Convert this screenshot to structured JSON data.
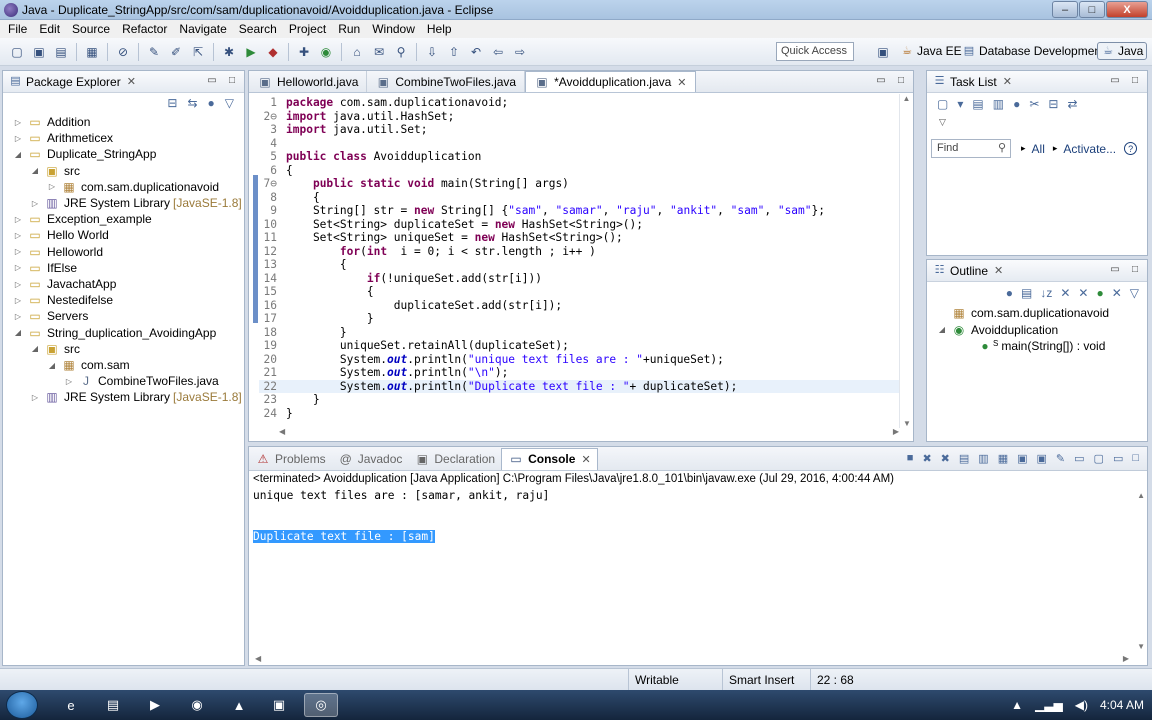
{
  "window": {
    "title": "Java - Duplicate_StringApp/src/com/sam/duplicationavoid/Avoidduplication.java - Eclipse",
    "min": "–",
    "max": "□",
    "close": "X"
  },
  "menu": [
    "File",
    "Edit",
    "Source",
    "Refactor",
    "Navigate",
    "Search",
    "Project",
    "Run",
    "Window",
    "Help"
  ],
  "toolbar": {
    "quick_access_placeholder": "Quick Access",
    "perspectives": [
      {
        "label": "Java EE",
        "icon": "java-ee-icon"
      },
      {
        "label": "Database Development",
        "icon": "database-icon"
      },
      {
        "label": "Java",
        "icon": "java-perspective-icon",
        "active": true
      }
    ]
  },
  "package_explorer": {
    "title": "Package Explorer",
    "close": "✕",
    "items": [
      {
        "label": "Addition",
        "indent": 0,
        "twisty": "▷",
        "icon": "project-icon"
      },
      {
        "label": "Arithmeticex",
        "indent": 0,
        "twisty": "▷",
        "icon": "project-icon"
      },
      {
        "label": "Duplicate_StringApp",
        "indent": 0,
        "twisty": "◢",
        "icon": "project-icon"
      },
      {
        "label": "src",
        "indent": 1,
        "twisty": "◢",
        "icon": "source-folder-icon"
      },
      {
        "label": "com.sam.duplicationavoid",
        "indent": 2,
        "twisty": "▷",
        "icon": "package-icon"
      },
      {
        "label": "JRE System Library",
        "suffix": "[JavaSE-1.8]",
        "indent": 1,
        "twisty": "▷",
        "icon": "library-icon"
      },
      {
        "label": "Exception_example",
        "indent": 0,
        "twisty": "▷",
        "icon": "project-icon"
      },
      {
        "label": "Hello World",
        "indent": 0,
        "twisty": "▷",
        "icon": "project-icon"
      },
      {
        "label": "Helloworld",
        "indent": 0,
        "twisty": "▷",
        "icon": "project-icon"
      },
      {
        "label": "IfElse",
        "indent": 0,
        "twisty": "▷",
        "icon": "project-icon"
      },
      {
        "label": "JavachatApp",
        "indent": 0,
        "twisty": "▷",
        "icon": "project-icon"
      },
      {
        "label": "Nestedifelse",
        "indent": 0,
        "twisty": "▷",
        "icon": "project-icon"
      },
      {
        "label": "Servers",
        "indent": 0,
        "twisty": "▷",
        "icon": "project-icon"
      },
      {
        "label": "String_duplication_AvoidingApp",
        "indent": 0,
        "twisty": "◢",
        "icon": "project-icon"
      },
      {
        "label": "src",
        "indent": 1,
        "twisty": "◢",
        "icon": "source-folder-icon"
      },
      {
        "label": "com.sam",
        "indent": 2,
        "twisty": "◢",
        "icon": "package-icon"
      },
      {
        "label": "CombineTwoFiles.java",
        "indent": 3,
        "twisty": "▷",
        "icon": "java-file-icon"
      },
      {
        "label": "JRE System Library",
        "suffix": "[JavaSE-1.8]",
        "indent": 1,
        "twisty": "▷",
        "icon": "library-icon"
      }
    ]
  },
  "editor": {
    "tabs": [
      {
        "label": "Helloworld.java",
        "active": false
      },
      {
        "label": "CombineTwoFiles.java",
        "active": false
      },
      {
        "label": "*Avoidduplication.java",
        "active": true,
        "close": "✕"
      }
    ],
    "lines": [
      {
        "n": "1",
        "html": "<span class=\"kw\">package</span> com.sam.duplicationavoid;"
      },
      {
        "n": "2⊖",
        "html": "<span class=\"kw\">import</span> java.util.HashSet;"
      },
      {
        "n": "3",
        "html": "<span class=\"kw\">import</span> java.util.Set;"
      },
      {
        "n": "4",
        "html": ""
      },
      {
        "n": "5",
        "html": "<span class=\"kw\">public class</span> Avoidduplication"
      },
      {
        "n": "6",
        "html": "{"
      },
      {
        "n": "7⊖",
        "html": "    <span class=\"kw\">public static void</span> main(String[] args)"
      },
      {
        "n": "8",
        "html": "    {"
      },
      {
        "n": "9",
        "html": "    String[] str = <span class=\"kw\">new</span> String[] {<span class=\"str\">\"sam\"</span>, <span class=\"str\">\"samar\"</span>, <span class=\"str\">\"raju\"</span>, <span class=\"str\">\"ankit\"</span>, <span class=\"str\">\"sam\"</span>, <span class=\"str\">\"sam\"</span>};"
      },
      {
        "n": "10",
        "html": "    Set&lt;String&gt; duplicateSet = <span class=\"kw\">new</span> HashSet&lt;String&gt;();"
      },
      {
        "n": "11",
        "html": "    Set&lt;String&gt; uniqueSet = <span class=\"kw\">new</span> HashSet&lt;String&gt;();"
      },
      {
        "n": "12",
        "html": "        <span class=\"kw\">for</span>(<span class=\"kw\">int</span>  i = 0; i &lt; str.length ; i++ )"
      },
      {
        "n": "13",
        "html": "        {"
      },
      {
        "n": "14",
        "html": "            <span class=\"kw\">if</span>(!uniqueSet.add(str[i]))"
      },
      {
        "n": "15",
        "html": "            {"
      },
      {
        "n": "16",
        "html": "                duplicateSet.add(str[i]);"
      },
      {
        "n": "17",
        "html": "            }"
      },
      {
        "n": "18",
        "html": "        }"
      },
      {
        "n": "19",
        "html": "        uniqueSet.retainAll(duplicateSet);"
      },
      {
        "n": "20",
        "html": "        System.<span class=\"ital\">out</span>.println(<span class=\"str\">\"unique text files are : \"</span>+uniqueSet);"
      },
      {
        "n": "21",
        "html": "        System.<span class=\"ital\">out</span>.println(<span class=\"str\">\"\\n\"</span>);"
      },
      {
        "n": "22",
        "html": "        System.<span class=\"ital\">out</span>.println(<span class=\"str\">\"Duplicate text file : \"</span>+ duplicateSet);"
      },
      {
        "n": "23",
        "html": "    }"
      },
      {
        "n": "24",
        "html": "}"
      }
    ]
  },
  "task_list": {
    "title": "Task List",
    "close": "✕",
    "find_placeholder": "Find",
    "all_label": "All",
    "activate_label": "Activate...",
    "all_arrow": "▸",
    "activate_arrow": "▸"
  },
  "outline": {
    "title": "Outline",
    "close": "✕",
    "items": [
      {
        "label": "com.sam.duplicationavoid",
        "indent": 0,
        "twisty": "",
        "icon": "package-icon"
      },
      {
        "label": "Avoidduplication",
        "indent": 0,
        "twisty": "◢",
        "icon": "class-icon"
      },
      {
        "label": "main(String[]) : void",
        "indent": 1,
        "twisty": "",
        "icon": "method-icon",
        "sup": "S"
      }
    ]
  },
  "console": {
    "tabs": [
      {
        "label": "Problems",
        "icon": "problems-icon",
        "active": false
      },
      {
        "label": "Javadoc",
        "icon": "javadoc-icon",
        "active": false
      },
      {
        "label": "Declaration",
        "icon": "declaration-icon",
        "active": false
      },
      {
        "label": "Console",
        "icon": "console-icon",
        "active": true,
        "close": "✕"
      }
    ],
    "status": "<terminated> Avoidduplication [Java Application] C:\\Program Files\\Java\\jre1.8.0_101\\bin\\javaw.exe (Jul 29, 2016, 4:00:44 AM)",
    "output": [
      {
        "text": "unique text files are : [samar, ankit, raju]",
        "selected": false
      },
      {
        "text": "",
        "selected": false
      },
      {
        "text": "",
        "selected": false
      },
      {
        "text": "Duplicate text file : [sam]",
        "selected": true
      }
    ]
  },
  "statusbar": {
    "writable": "Writable",
    "insert_mode": "Smart Insert",
    "position": "22 : 68"
  },
  "taskbar": {
    "time": "4:04 AM"
  }
}
